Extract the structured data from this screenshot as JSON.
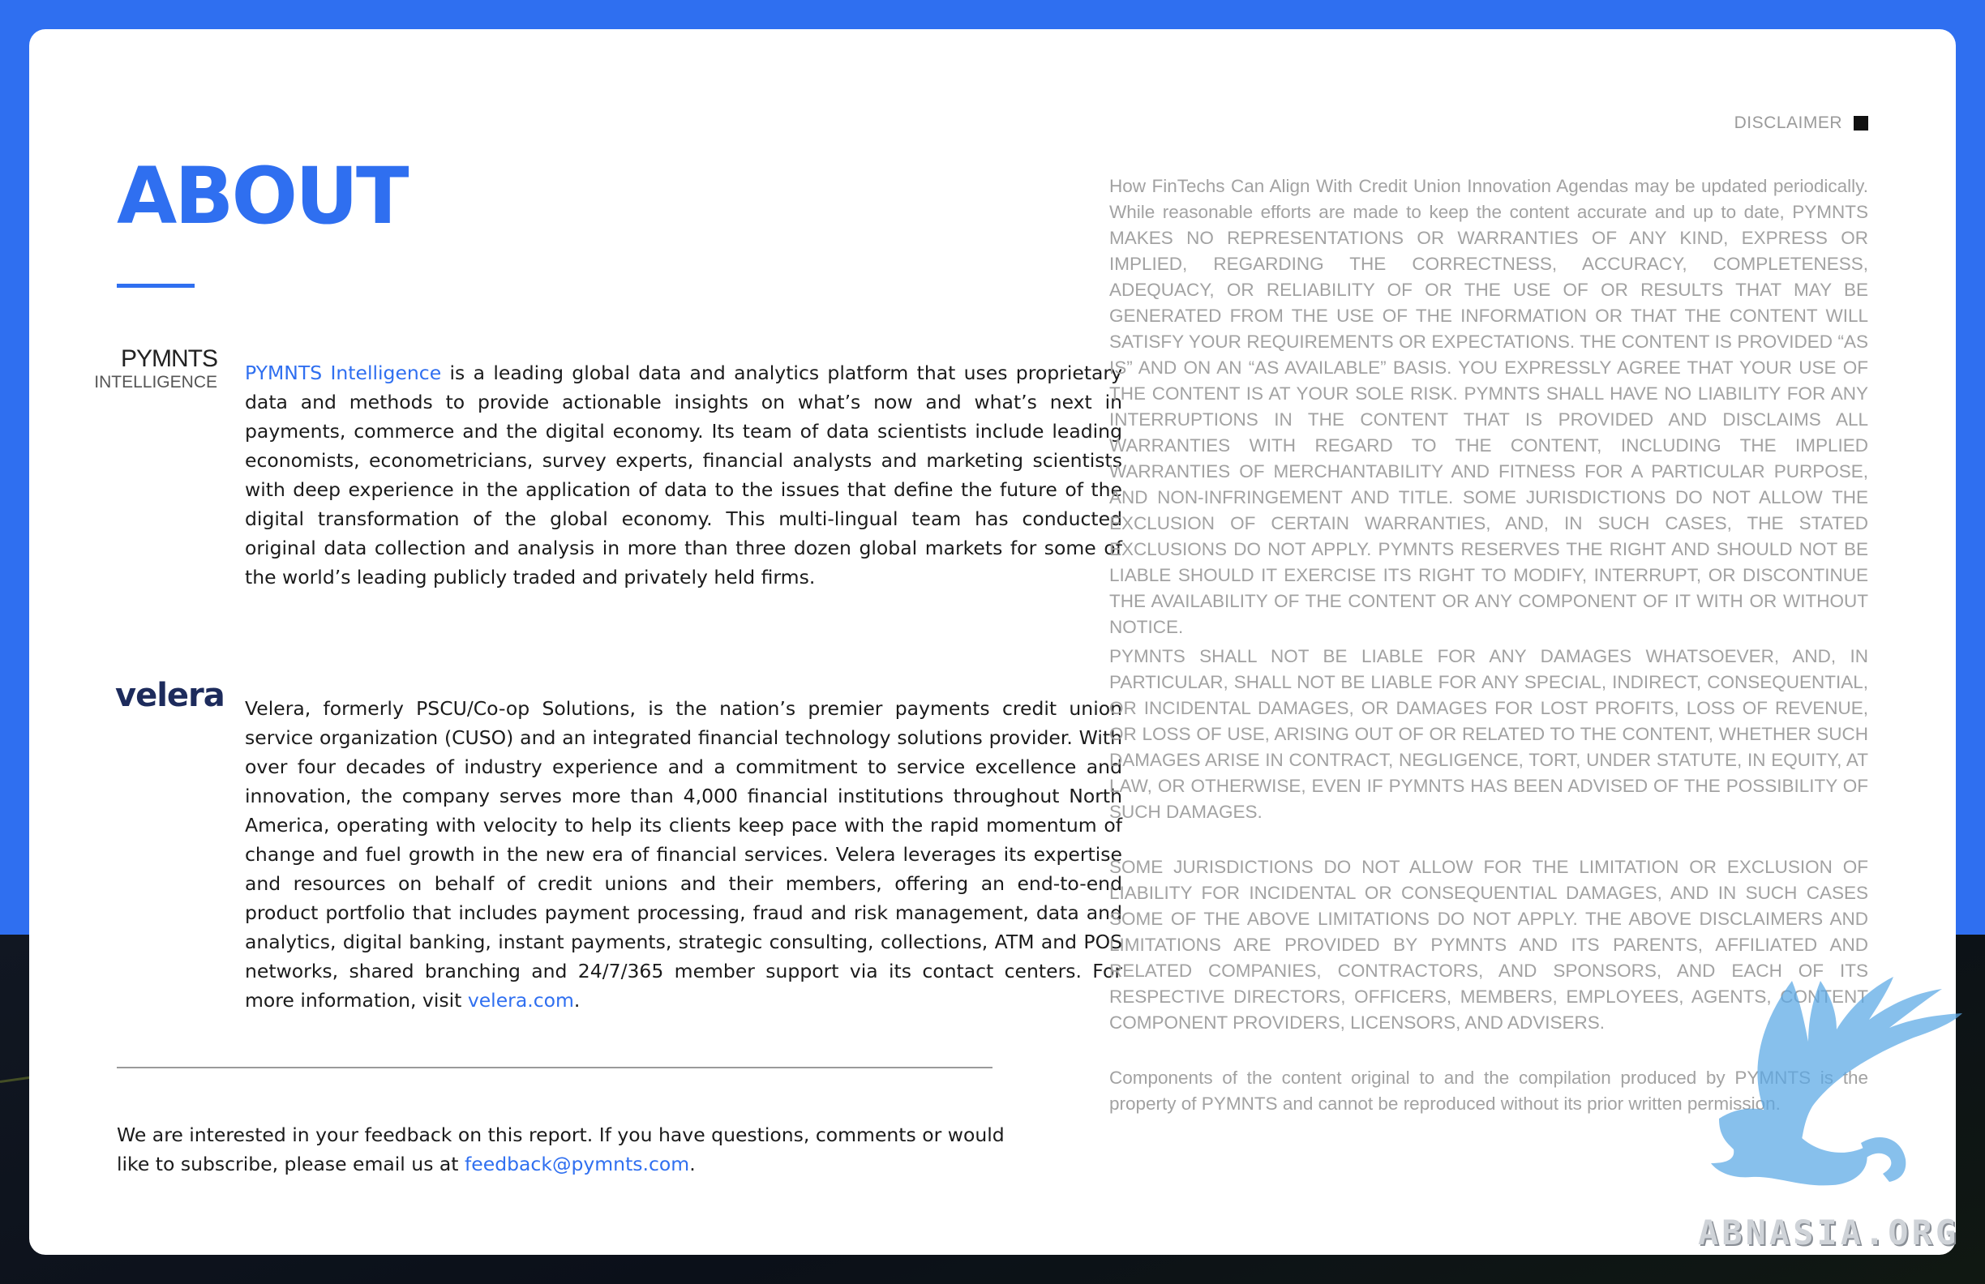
{
  "header": {
    "title": "ABOUT",
    "disclaimer_label": "DISCLAIMER"
  },
  "pymnts": {
    "logo_line1": "PYMNTS",
    "logo_line2": "INTELLIGENCE",
    "link_text": "PYMNTS Intelligence",
    "body": " is a leading global data and analytics platform that uses proprietary data and methods to provide actionable insights on what’s now and what’s next in payments, commerce and the digital economy. Its team of data scientists include leading economists, econometricians, survey experts, financial analysts and marketing scientists with deep experience in the application of data to the issues that define the future of the digital transformation of the global economy. This multi-lingual team has conducted original data collection and analysis in more than three dozen global markets for some of the world’s leading publicly traded and privately held firms."
  },
  "velera": {
    "logo": "velera",
    "body": "Velera, formerly PSCU/Co-op Solutions, is the nation’s premier payments credit union service organization (CUSO) and an integrated financial technology solutions provider. With over four decades of industry experience and a commitment to service excellence and innovation, the company serves more than 4,000 financial institutions throughout North America, operating with velocity to help its clients keep pace with the rapid momentum of change and fuel growth in the new era of financial services. Velera leverages its expertise and resources on behalf of credit unions and their members, offering an end-to-end product portfolio that includes payment processing, fraud and risk management, data and analytics, digital banking, instant payments, strategic consulting, collections, ATM and POS networks, shared branching and 24/7/365 member support via its contact centers. For more information, visit ",
    "link_text": "velera.com",
    "tail": "."
  },
  "feedback": {
    "line1": "We are interested in your feedback on this report. If you have questions, comments or would like to subscribe, please email us at ",
    "email": "feedback@pymnts.com",
    "tail": "."
  },
  "disclaimer": {
    "p1": "How FinTechs Can Align With Credit Union Innovation Agendas may be updated periodically. While reasonable efforts are made to keep the content accurate and up to date, PYMNTS MAKES NO REPRESENTATIONS OR WARRANTIES OF ANY KIND, EXPRESS OR IMPLIED, REGARDING THE CORRECTNESS, ACCURACY, COMPLETENESS, ADEQUACY, OR RELIABILITY OF OR THE USE OF OR RESULTS THAT MAY BE GENERATED FROM THE USE OF THE INFORMATION OR THAT THE CONTENT WILL SATISFY YOUR REQUIREMENTS OR EXPECTATIONS. THE CONTENT IS PROVIDED “AS IS” AND ON AN “AS AVAILABLE” BASIS. YOU EXPRESSLY AGREE THAT YOUR USE OF THE CONTENT IS AT YOUR SOLE RISK. PYMNTS SHALL HAVE NO LIABILITY FOR ANY INTERRUPTIONS IN THE CONTENT THAT IS PROVIDED AND DISCLAIMS ALL WARRANTIES WITH REGARD TO THE CONTENT, INCLUDING THE IMPLIED WARRANTIES OF MERCHANTABILITY AND FITNESS FOR A PARTICULAR PURPOSE, AND NON-INFRINGEMENT AND TITLE. SOME JURISDICTIONS DO NOT ALLOW THE EXCLUSION OF CERTAIN WARRANTIES, AND, IN SUCH CASES, THE STATED EXCLUSIONS DO NOT APPLY. PYMNTS RESERVES THE RIGHT AND SHOULD NOT BE LIABLE SHOULD IT EXERCISE ITS RIGHT TO MODIFY, INTERRUPT, OR DISCONTINUE THE AVAILABILITY OF THE CONTENT OR ANY COMPONENT OF IT WITH OR WITHOUT NOTICE.",
    "p2": "PYMNTS SHALL NOT BE LIABLE FOR ANY DAMAGES WHATSOEVER, AND, IN PARTICULAR, SHALL NOT BE LIABLE FOR ANY SPECIAL, INDIRECT, CONSEQUENTIAL, OR INCIDENTAL DAMAGES, OR DAMAGES FOR LOST PROFITS, LOSS OF REVENUE, OR LOSS OF USE, ARISING OUT OF OR RELATED TO THE CONTENT, WHETHER SUCH DAMAGES ARISE IN CONTRACT, NEGLIGENCE, TORT, UNDER STATUTE, IN EQUITY, AT LAW, OR OTHERWISE, EVEN IF PYMNTS HAS BEEN ADVISED OF THE POSSIBILITY OF SUCH DAMAGES.",
    "p3": "SOME JURISDICTIONS DO NOT ALLOW FOR THE LIMITATION OR EXCLUSION OF LIABILITY FOR INCIDENTAL OR CONSEQUENTIAL DAMAGES, AND IN SUCH CASES SOME OF THE ABOVE LIMITATIONS DO NOT APPLY. THE ABOVE DISCLAIMERS AND LIMITATIONS ARE PROVIDED BY PYMNTS AND ITS PARENTS, AFFILIATED AND RELATED COMPANIES, CONTRACTORS, AND SPONSORS, AND EACH OF ITS RESPECTIVE DIRECTORS, OFFICERS, MEMBERS, EMPLOYEES, AGENTS, CONTENT COMPONENT PROVIDERS, LICENSORS, AND ADVISERS.",
    "p4": "Components of the content original to and the compilation produced by PYMNTS is the property of PYMNTS and cannot be reproduced without its prior written permission."
  },
  "watermark": {
    "text": "ABNASIA.ORG"
  },
  "colors": {
    "accent": "#2f6ff0",
    "body_text": "#1b1b1b",
    "disclaimer_text": "#a2a2a2",
    "velera_navy": "#1d2b5c"
  }
}
